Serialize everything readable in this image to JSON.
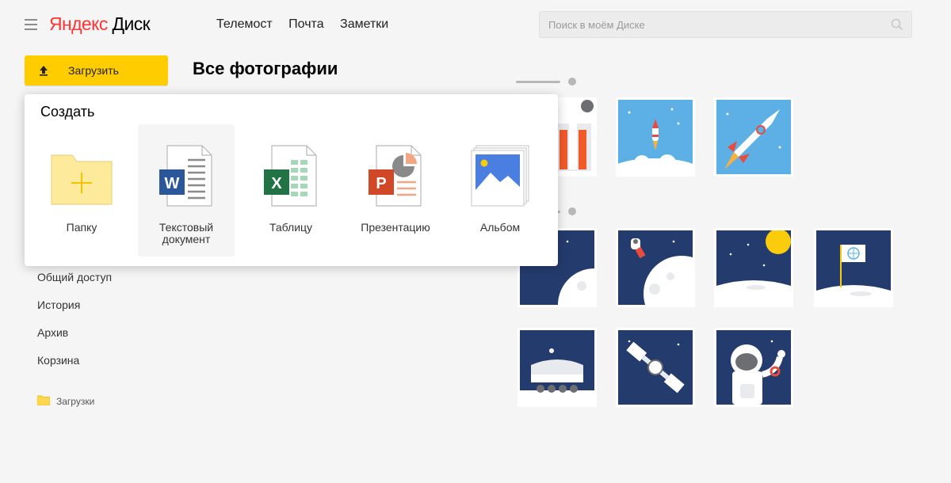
{
  "header": {
    "logo_ya": "Яндекс",
    "logo_disk": "Диск",
    "nav": [
      "Телемост",
      "Почта",
      "Заметки"
    ],
    "search_placeholder": "Поиск в моём Диске"
  },
  "upload": {
    "label": "Загрузить"
  },
  "page_title": "Все фотографии",
  "sidebar": {
    "items": [
      "Общий доступ",
      "История",
      "Архив",
      "Корзина"
    ],
    "folder": "Загрузки"
  },
  "create_menu": {
    "title": "Создать",
    "items": [
      {
        "label": "Папку",
        "icon": "folder-plus-icon"
      },
      {
        "label": "Текстовый документ",
        "icon": "word-document-icon"
      },
      {
        "label": "Таблицу",
        "icon": "excel-spreadsheet-icon"
      },
      {
        "label": "Презентацию",
        "icon": "powerpoint-presentation-icon"
      },
      {
        "label": "Альбом",
        "icon": "album-icon"
      }
    ]
  },
  "colors": {
    "accent": "#ffcc00",
    "brand_red": "#ff3333",
    "space_navy": "#243b6e",
    "sky_blue": "#5cb0e6"
  }
}
